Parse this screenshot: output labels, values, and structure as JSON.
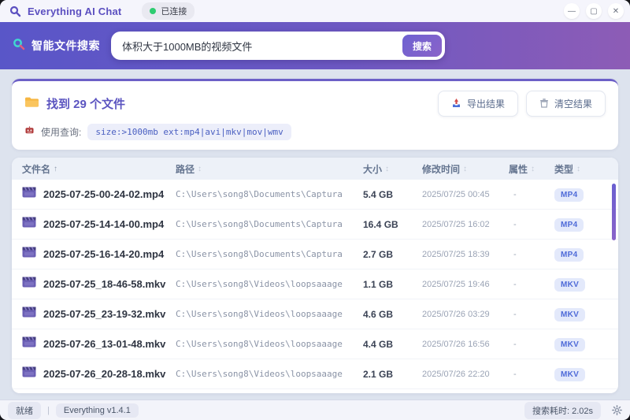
{
  "titlebar": {
    "app_title": "Everything AI Chat",
    "connection_status": "已连接",
    "minimize": "—",
    "maximize": "▢",
    "close": "✕"
  },
  "search": {
    "label": "智能文件搜索",
    "input_value": "体积大于1000MB的视频文件",
    "search_button": "搜索"
  },
  "results_header": {
    "found_text": "找到 29 个文件",
    "query_label": "使用查询:",
    "query_value": "size:>1000mb ext:mp4|avi|mkv|mov|wmv",
    "export_button": "导出结果",
    "clear_button": "清空结果"
  },
  "table": {
    "columns": [
      {
        "label": "文件名",
        "sort": "↑",
        "active": true
      },
      {
        "label": "路径",
        "sort": "↕",
        "active": false
      },
      {
        "label": "大小",
        "sort": "↕",
        "active": false
      },
      {
        "label": "修改时间",
        "sort": "↕",
        "active": false
      },
      {
        "label": "属性",
        "sort": "↕",
        "active": false
      },
      {
        "label": "类型",
        "sort": "↕",
        "active": false
      }
    ],
    "rows": [
      {
        "name": "2025-07-25-00-24-02.mp4",
        "path": "C:\\Users\\song8\\Documents\\Captura",
        "size": "5.4 GB",
        "modified": "2025/07/25 00:45",
        "attr": "-",
        "type": "MP4"
      },
      {
        "name": "2025-07-25-14-14-00.mp4",
        "path": "C:\\Users\\song8\\Documents\\Captura",
        "size": "16.4 GB",
        "modified": "2025/07/25 16:02",
        "attr": "-",
        "type": "MP4"
      },
      {
        "name": "2025-07-25-16-14-20.mp4",
        "path": "C:\\Users\\song8\\Documents\\Captura",
        "size": "2.7 GB",
        "modified": "2025/07/25 18:39",
        "attr": "-",
        "type": "MP4"
      },
      {
        "name": "2025-07-25_18-46-58.mkv",
        "path": "C:\\Users\\song8\\Videos\\loopsaaage",
        "size": "1.1 GB",
        "modified": "2025/07/25 19:46",
        "attr": "-",
        "type": "MKV"
      },
      {
        "name": "2025-07-25_23-19-32.mkv",
        "path": "C:\\Users\\song8\\Videos\\loopsaaage",
        "size": "4.6 GB",
        "modified": "2025/07/26 03:29",
        "attr": "-",
        "type": "MKV"
      },
      {
        "name": "2025-07-26_13-01-48.mkv",
        "path": "C:\\Users\\song8\\Videos\\loopsaaage",
        "size": "4.4 GB",
        "modified": "2025/07/26 16:56",
        "attr": "-",
        "type": "MKV"
      },
      {
        "name": "2025-07-26_20-28-18.mkv",
        "path": "C:\\Users\\song8\\Videos\\loopsaaage",
        "size": "2.1 GB",
        "modified": "2025/07/26 22:20",
        "attr": "-",
        "type": "MKV"
      }
    ]
  },
  "statusbar": {
    "ready": "就绪",
    "separator": "|",
    "version": "Everything v1.4.1",
    "elapsed": "搜索耗时: 2.02s"
  },
  "colors": {
    "accent_purple": "#5b4fc0",
    "search_gradient_start": "#5956c8",
    "search_gradient_end": "#8d5cb6",
    "connected_green": "#2ecc71",
    "badge_blue_bg": "#e3e9fb",
    "badge_blue_text": "#4f6bd8",
    "main_background": "#dde3ee"
  }
}
